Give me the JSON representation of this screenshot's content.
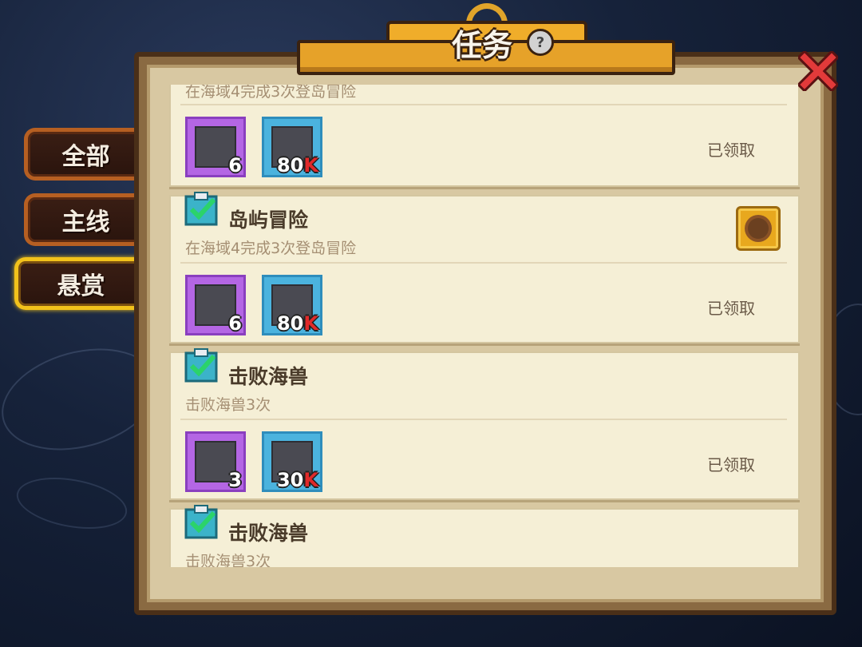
{
  "header": {
    "title": "任务",
    "help_glyph": "?"
  },
  "tabs": [
    {
      "label": "全部",
      "selected": false
    },
    {
      "label": "主线",
      "selected": false
    },
    {
      "label": "悬赏",
      "selected": true
    }
  ],
  "quests": [
    {
      "title": "",
      "desc": "在海域4完成3次登岛冒险",
      "rewards": [
        {
          "icon": "material-crate-icon",
          "count": "6",
          "suffix": ""
        },
        {
          "icon": "coin-icon",
          "count": "80",
          "suffix": "K"
        }
      ],
      "status": "已领取",
      "has_chest": true
    },
    {
      "title": "岛屿冒险",
      "desc": "在海域4完成3次登岛冒险",
      "rewards": [
        {
          "icon": "material-crate-icon",
          "count": "6",
          "suffix": ""
        },
        {
          "icon": "coin-icon",
          "count": "80",
          "suffix": "K"
        }
      ],
      "status": "已领取",
      "has_chest": true
    },
    {
      "title": "击败海兽",
      "desc": "击败海兽3次",
      "rewards": [
        {
          "icon": "material-crate-icon",
          "count": "3",
          "suffix": ""
        },
        {
          "icon": "coin-icon",
          "count": "30",
          "suffix": "K"
        }
      ],
      "status": "已领取",
      "has_chest": false
    },
    {
      "title": "击败海兽",
      "desc": "击败海兽3次",
      "rewards": [],
      "status": "",
      "has_chest": false
    }
  ],
  "colors": {
    "accent_gold": "#e6a229",
    "tab_selected_border": "#f2c21b",
    "close_red": "#e23a3a",
    "purple_rarity": "#b466e4",
    "blue_rarity": "#4bb3de"
  }
}
